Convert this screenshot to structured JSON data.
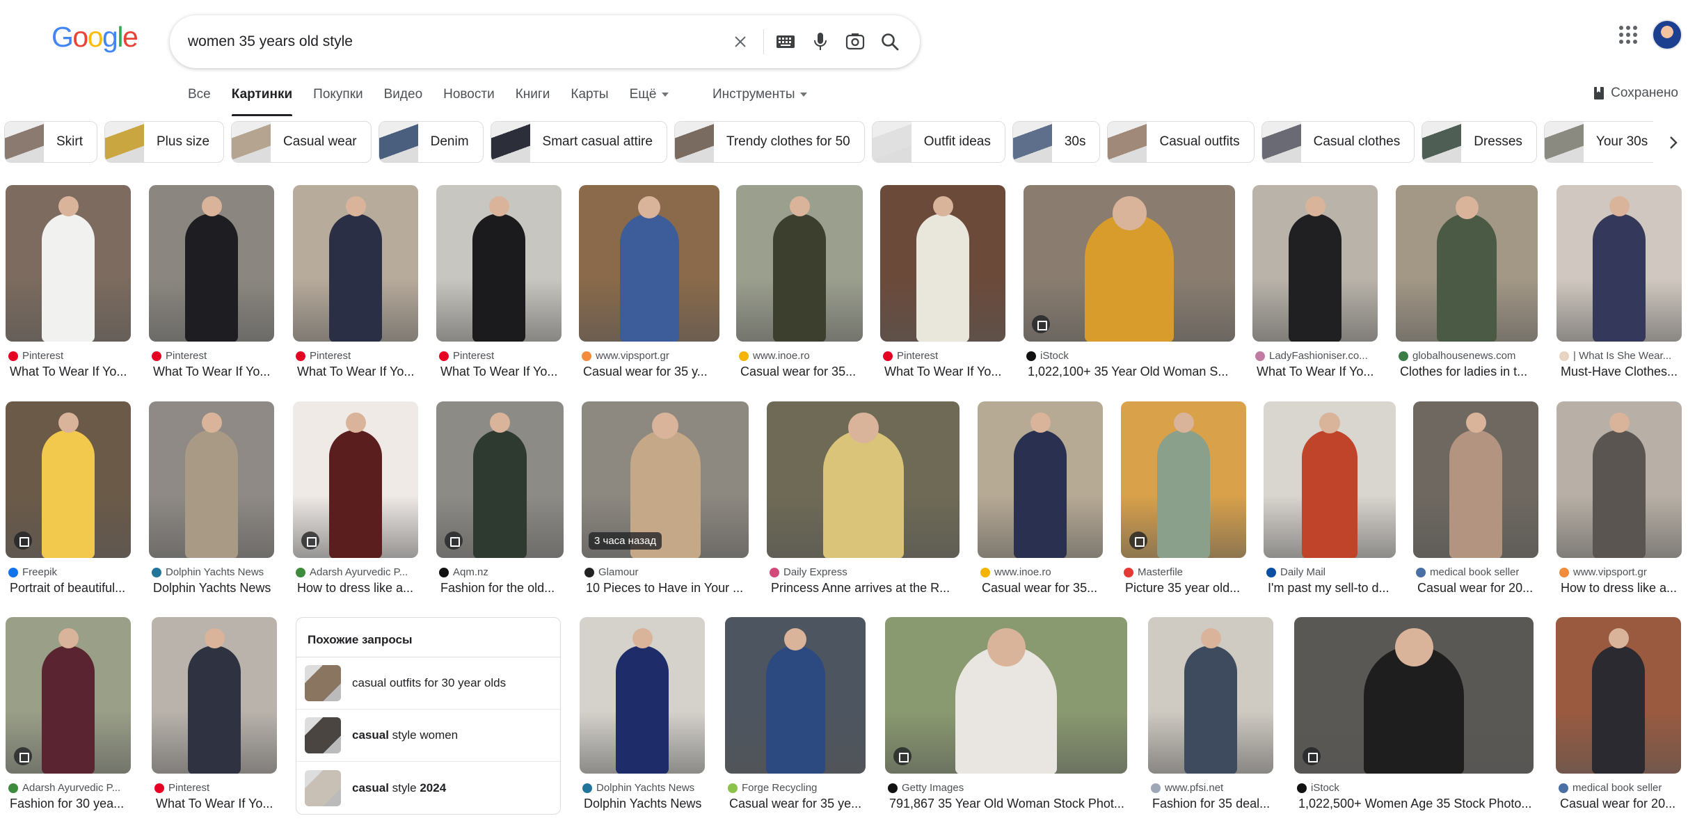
{
  "logo": {
    "letters": [
      "G",
      "o",
      "o",
      "g",
      "l",
      "e"
    ],
    "colors": [
      "#4285F4",
      "#EA4335",
      "#FBBC05",
      "#4285F4",
      "#34A853",
      "#EA4335"
    ]
  },
  "search": {
    "query": "women 35 years old style"
  },
  "tabs": [
    {
      "label": "Все",
      "active": false
    },
    {
      "label": "Картинки",
      "active": true
    },
    {
      "label": "Покупки",
      "active": false
    },
    {
      "label": "Видео",
      "active": false
    },
    {
      "label": "Новости",
      "active": false
    },
    {
      "label": "Книги",
      "active": false
    },
    {
      "label": "Карты",
      "active": false
    },
    {
      "label": "Ещё",
      "active": false
    }
  ],
  "tools_label": "Инструменты",
  "saved_label": "Сохранено",
  "chips": [
    {
      "label": "Skirt",
      "color": "#8a7a70"
    },
    {
      "label": "Plus size",
      "color": "#c9a640"
    },
    {
      "label": "Casual wear",
      "color": "#b5a590"
    },
    {
      "label": "Denim",
      "color": "#4a5e7d"
    },
    {
      "label": "Smart casual attire",
      "color": "#2c2f3a"
    },
    {
      "label": "Trendy clothes for 50",
      "color": "#7a6b60"
    },
    {
      "label": "Outfit ideas",
      "color": "#e0e0e0"
    },
    {
      "label": "30s",
      "color": "#5d6f8a"
    },
    {
      "label": "Casual outfits",
      "color": "#a08978"
    },
    {
      "label": "Casual clothes",
      "color": "#6a6a75"
    },
    {
      "label": "Dresses",
      "color": "#4e5e55"
    },
    {
      "label": "Your 30s",
      "color": "#8a8a80"
    },
    {
      "label": "",
      "color": "#d8d8d8"
    }
  ],
  "results": [
    {
      "source": "Pinterest",
      "title": "What To Wear If Yo...",
      "fav": "#e60023",
      "bg": "#7c6b5e",
      "fig": "#f1f1ef",
      "badge": ""
    },
    {
      "source": "Pinterest",
      "title": "What To Wear If Yo...",
      "fav": "#e60023",
      "bg": "#8b8780",
      "fig": "#1e1e22",
      "badge": ""
    },
    {
      "source": "Pinterest",
      "title": "What To Wear If Yo...",
      "fav": "#e60023",
      "bg": "#b7ab9b",
      "fig": "#2b2f45",
      "badge": ""
    },
    {
      "source": "Pinterest",
      "title": "What To Wear If Yo...",
      "fav": "#e60023",
      "bg": "#c8c6c0",
      "fig": "#1b1b1d",
      "badge": ""
    },
    {
      "source": "www.vipsport.gr",
      "title": "Casual wear for 35 y...",
      "fav": "#f28b3c",
      "bg": "#8a6a4a",
      "fig": "#3c5d9a",
      "badge": ""
    },
    {
      "source": "www.inoe.ro",
      "title": "Casual wear for 35...",
      "fav": "#f4b400",
      "bg": "#9b9f8e",
      "fig": "#3c3e2e",
      "badge": ""
    },
    {
      "source": "Pinterest",
      "title": "What To Wear If Yo...",
      "fav": "#e60023",
      "bg": "#6b4a3a",
      "fig": "#e9e6dc",
      "badge": ""
    },
    {
      "source": "iStock",
      "title": "1,022,100+ 35 Year Old Woman S...",
      "fav": "#111111",
      "bg": "#8a7d70",
      "fig": "#d79c2b",
      "badge": "icon"
    },
    {
      "source": "LadyFashioniser.co...",
      "title": "What To Wear If Yo...",
      "fav": "#c27ba0",
      "bg": "#b9b3aa",
      "fig": "#202022",
      "badge": ""
    },
    {
      "source": "globalhousenews.com",
      "title": "Clothes for ladies in t...",
      "fav": "#3a7d44",
      "bg": "#a39886",
      "fig": "#4b5a44",
      "badge": ""
    },
    {
      "source": "| What Is She Wear...",
      "title": "Must-Have Clothes...",
      "fav": "#e8d4c0",
      "bg": "#d0c8c0",
      "fig": "#34385a",
      "badge": ""
    },
    {
      "source": "Freepik",
      "title": "Portrait of beautiful...",
      "fav": "#1273eb",
      "bg": "#6b5a48",
      "fig": "#f2c94c",
      "badge": "icon"
    },
    {
      "source": "Dolphin Yachts News",
      "title": "Dolphin Yachts News",
      "fav": "#21759b",
      "bg": "#8f8a85",
      "fig": "#a89a84",
      "badge": ""
    },
    {
      "source": "Adarsh Ayurvedic P...",
      "title": "How to dress like a...",
      "fav": "#3d8b3d",
      "bg": "#efeae6",
      "fig": "#5a1e1e",
      "badge": "icon"
    },
    {
      "source": "Aqm.nz",
      "title": "Fashion for the old...",
      "fav": "#111111",
      "bg": "#8d8b86",
      "fig": "#2e3a30",
      "badge": "icon"
    },
    {
      "source": "Glamour",
      "title": "10 Pieces to Have in Your ...",
      "fav": "#222222",
      "bg": "#8d8880",
      "fig": "#c4a887",
      "badge": "time",
      "badge_text": "3 часа назад"
    },
    {
      "source": "Daily Express",
      "title": "Princess Anne arrives at the R...",
      "fav": "#d14a7a",
      "bg": "#6e6a55",
      "fig": "#d9c47a",
      "badge": ""
    },
    {
      "source": "www.inoe.ro",
      "title": "Casual wear for 35...",
      "fav": "#f4b400",
      "bg": "#b7aa95",
      "fig": "#2a3050",
      "badge": ""
    },
    {
      "source": "Masterfile",
      "title": "Picture 35 year old...",
      "fav": "#e53935",
      "bg": "#d9a14a",
      "fig": "#8aa08a",
      "badge": "icon"
    },
    {
      "source": "Daily Mail",
      "title": "I'm past my sell-to d...",
      "fav": "#0b4ea2",
      "bg": "#d9d5cf",
      "fig": "#c0442a",
      "badge": ""
    },
    {
      "source": "medical book seller",
      "title": "Casual wear for 20...",
      "fav": "#4a6fa5",
      "bg": "#6e6860",
      "fig": "#b39480",
      "badge": ""
    },
    {
      "source": "www.vipsport.gr",
      "title": "How to dress like a...",
      "fav": "#f28b3c",
      "bg": "#b8b0a6",
      "fig": "#5a5550",
      "badge": ""
    },
    {
      "source": "Adarsh Ayurvedic P...",
      "title": "Fashion for 30 yea...",
      "fav": "#3d8b3d",
      "bg": "#9a9f88",
      "fig": "#5a2530",
      "badge": "icon"
    },
    {
      "source": "Pinterest",
      "title": "What To Wear If Yo...",
      "fav": "#e60023",
      "bg": "#b9b3ac",
      "fig": "#2f3240",
      "badge": ""
    },
    {
      "source": "Dolphin Yachts News",
      "title": "Dolphin Yachts News",
      "fav": "#21759b",
      "bg": "#d5d2cc",
      "fig": "#1e2d6a",
      "badge": ""
    },
    {
      "source": "Forge Recycling",
      "title": "Casual wear for 35 ye...",
      "fav": "#8bc34a",
      "bg": "#4d5560",
      "fig": "#2d4a80",
      "badge": ""
    },
    {
      "source": "Getty Images",
      "title": "791,867 35 Year Old Woman Stock Phot...",
      "fav": "#111111",
      "bg": "#8a9a70",
      "fig": "#e9e6e2",
      "badge": "icon"
    },
    {
      "source": "www.pfsi.net",
      "title": "Fashion for 35 deal...",
      "fav": "#9ea7b8",
      "bg": "#cfcac2",
      "fig": "#3e4a5e",
      "badge": ""
    },
    {
      "source": "iStock",
      "title": "1,022,500+ Women Age 35 Stock Photo...",
      "fav": "#111111",
      "bg": "#5a5854",
      "fig": "#1e1e1e",
      "badge": "icon"
    },
    {
      "source": "medical book seller",
      "title": "Casual wear for 20...",
      "fav": "#4a6fa5",
      "bg": "#9a5a40",
      "fig": "#2a2a30",
      "badge": ""
    }
  ],
  "related": {
    "title": "Похожие запросы",
    "items": [
      {
        "plain": "casual outfits for 30 year olds",
        "bold": "",
        "after": "",
        "color": "#8a7560"
      },
      {
        "plain": "",
        "bold": "casual",
        "after": " style women",
        "color": "#4a4540"
      },
      {
        "plain": "",
        "bold": "casual",
        "after": " style ",
        "bold2": "2024",
        "color": "#c8c0b5"
      }
    ]
  }
}
